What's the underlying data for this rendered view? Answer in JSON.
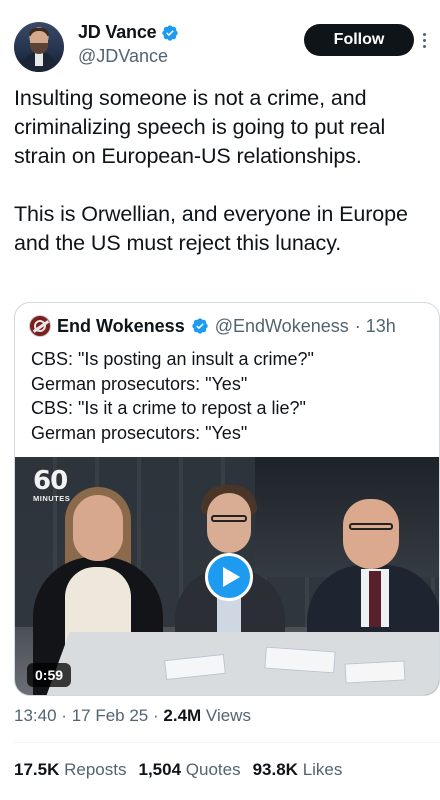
{
  "author": {
    "name": "JD Vance",
    "handle": "@JDVance",
    "follow_label": "Follow"
  },
  "tweet": {
    "paragraphs": [
      "Insulting someone is not a crime, and criminalizing speech is going to put real strain on European-US relationships.",
      "This is Orwellian, and everyone in Europe and the US must reject this lunacy."
    ]
  },
  "quoted": {
    "name": "End Wokeness",
    "handle": "@EndWokeness",
    "time": "· 13h",
    "lines": [
      "CBS: \"Is posting an insult a crime?\"",
      "German prosecutors: \"Yes\"",
      "CBS: \"Is it a crime to repost a lie?\"",
      "German prosecutors: \"Yes\""
    ],
    "video": {
      "logo_number": "60",
      "logo_text": "MINUTES",
      "duration": "0:59"
    }
  },
  "meta": {
    "time": "13:40",
    "date": "17 Feb 25",
    "views_count": "2.4M",
    "views_label": "Views",
    "sep": "·"
  },
  "stats": {
    "reposts_count": "17.5K",
    "reposts_label": "Reposts",
    "quotes_count": "1,504",
    "quotes_label": "Quotes",
    "likes_count": "93.8K",
    "likes_label": "Likes"
  },
  "colors": {
    "verified": "#1d9bf0",
    "secondary_text": "#536471",
    "primary_text": "#0f1419",
    "follow_bg": "#0f1419"
  }
}
